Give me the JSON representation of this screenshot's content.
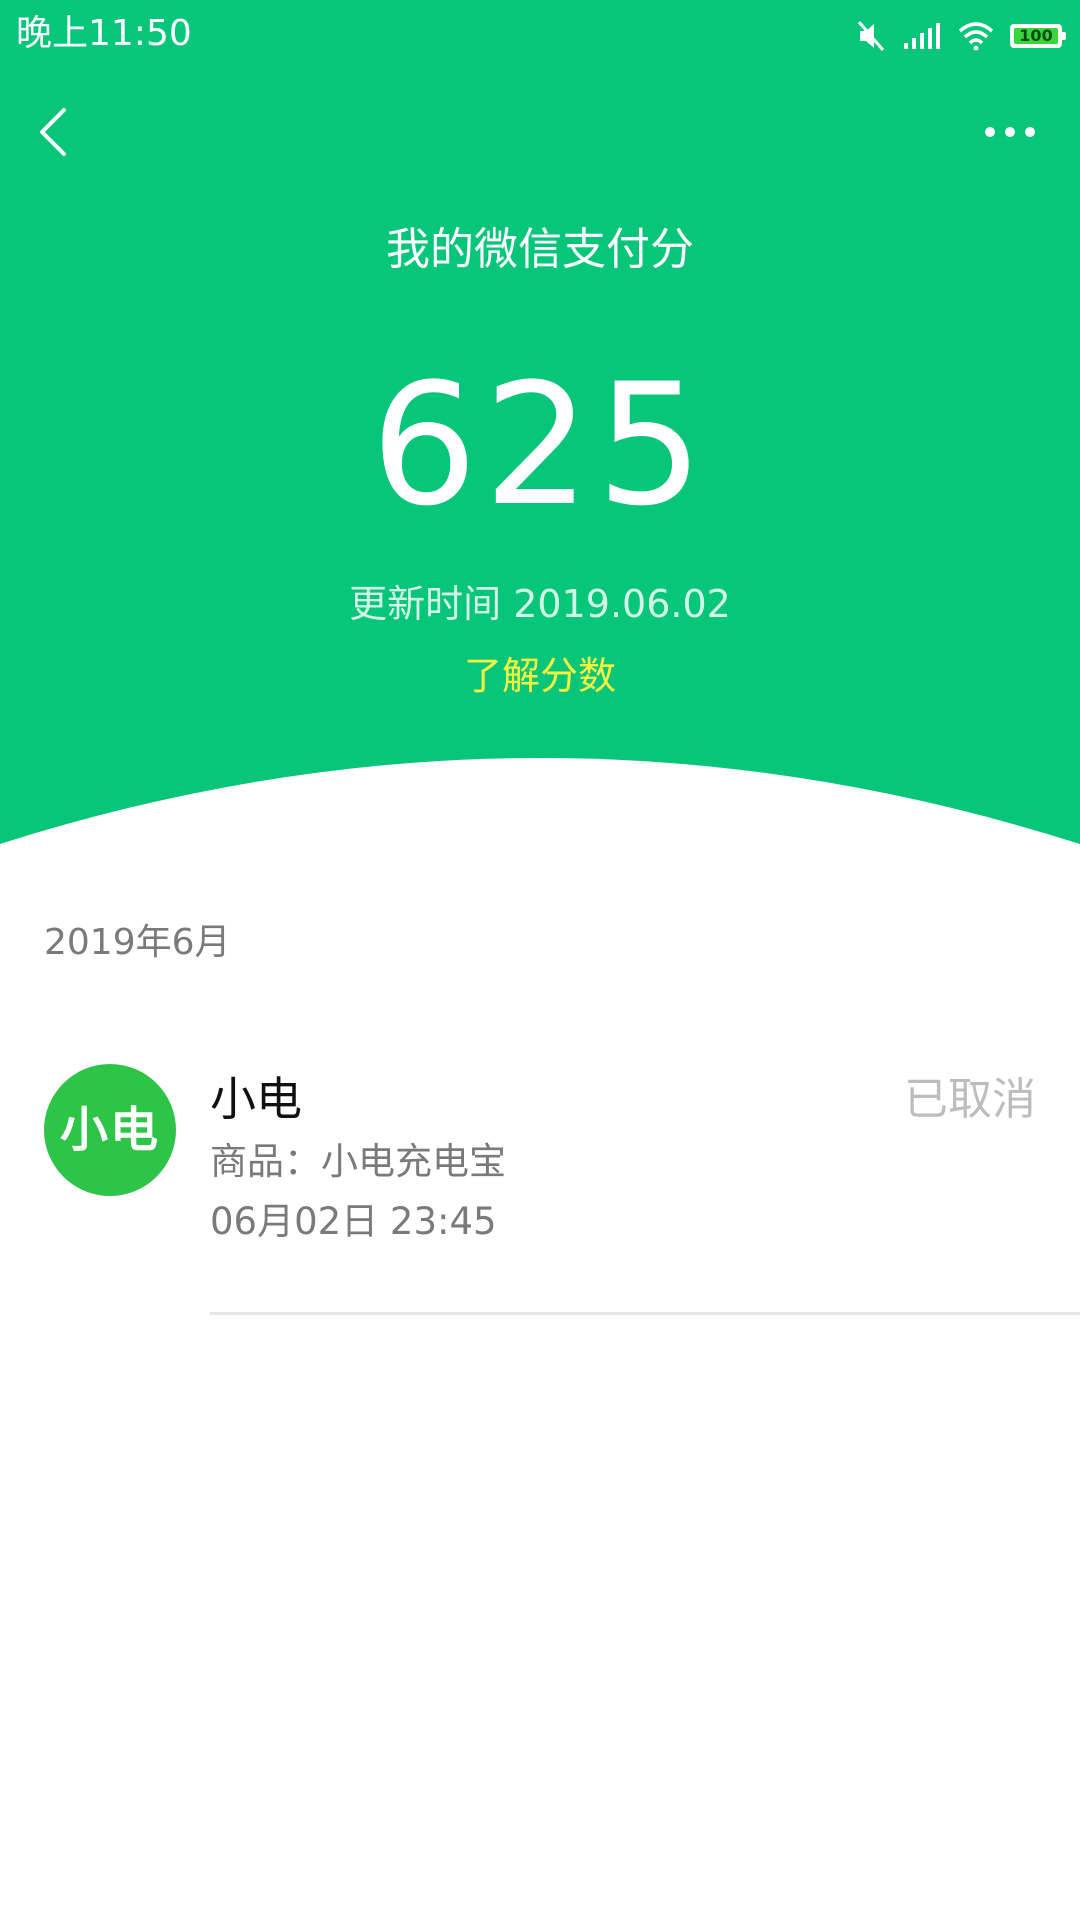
{
  "status_bar": {
    "time": "晚上11:50",
    "battery": "100",
    "icons": [
      "mute-icon",
      "signal-icon",
      "wifi-icon",
      "battery-icon"
    ]
  },
  "nav": {
    "back_icon": "chevron-left-icon",
    "more_icon": "ellipsis-icon"
  },
  "hero": {
    "title": "我的微信支付分",
    "score": "625",
    "updated": "更新时间 2019.06.02",
    "learn_link": "了解分数"
  },
  "records": {
    "month": "2019年6月",
    "items": [
      {
        "avatar_text": "小电",
        "merchant": "小电",
        "status": "已取消",
        "product": "商品：小电充电宝",
        "time": "06月02日 23:45"
      }
    ]
  },
  "colors": {
    "hero_green": "#07C67A",
    "link_yellow": "#F6F340",
    "avatar_green": "#2DC447",
    "status_gray": "#BDBDBD"
  }
}
